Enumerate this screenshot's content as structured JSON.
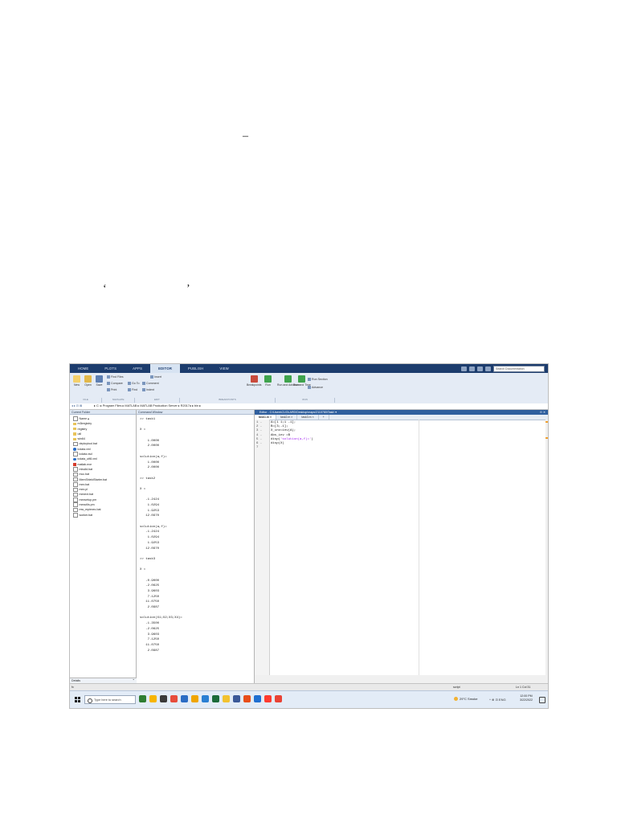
{
  "document": {
    "dash": "–",
    "left_quote": "‘",
    "right_quote": "’"
  },
  "app": {
    "tabs": [
      "HOME",
      "PLOTS",
      "APPS",
      "EDITOR",
      "PUBLISH",
      "VIEW"
    ],
    "active_tab": "EDITOR",
    "search_placeholder": "Search Documentation"
  },
  "ribbon": {
    "items": [
      {
        "label": "New",
        "color": "#f4d06b"
      },
      {
        "label": "Open",
        "color": "#e2b84a"
      },
      {
        "label": "Save",
        "color": "#5d7fb3"
      },
      {
        "label": "Breakpoints",
        "color": "#c94b3c"
      },
      {
        "label": "Run",
        "color": "#3fa34d"
      },
      {
        "label": "Run and Advance",
        "color": "#3fa34d"
      },
      {
        "label": "Run and Time",
        "color": "#3fa34d"
      }
    ],
    "small": [
      "Find Files",
      "Compare",
      "Print",
      "Insert",
      "Comment",
      "Indent",
      "Go To",
      "Find",
      "Run Section",
      "Advance"
    ],
    "groups": [
      "FILE",
      "NAVIGATE",
      "EDIT",
      "BREAKPOINTS",
      "RUN"
    ]
  },
  "address": {
    "nav": "◂ ▸ ⊡ ⊠",
    "path": "▸ C: ▸ Program Files ▸ MATLAB ▸ MATLAB Production Server ▸ R2017a ▸ bin ▸"
  },
  "current_folder": {
    "title": "Current Folder",
    "column": "Name ▴",
    "items": [
      {
        "name": "m3iregistry",
        "icon": "folder"
      },
      {
        "name": "registry",
        "icon": "folder"
      },
      {
        "name": "util",
        "icon": "folder"
      },
      {
        "name": "win64",
        "icon": "folder"
      },
      {
        "name": "deploytool.bat",
        "icon": "file"
      },
      {
        "name": "lcdata.xml",
        "icon": "blue"
      },
      {
        "name": "lcdata.xsd",
        "icon": "file"
      },
      {
        "name": "lcdata_utf8.xml",
        "icon": "blue"
      },
      {
        "name": "matlab.exe",
        "icon": "red"
      },
      {
        "name": "mbuild.bat",
        "icon": "file"
      },
      {
        "name": "mcc.bat",
        "icon": "file"
      },
      {
        "name": "MemShieldStarter.bat",
        "icon": "file"
      },
      {
        "name": "mex.bat",
        "icon": "file"
      },
      {
        "name": "mex.pl",
        "icon": "file"
      },
      {
        "name": "mexext.bat",
        "icon": "file"
      },
      {
        "name": "mexsetup.pm",
        "icon": "file"
      },
      {
        "name": "mexutils.pm",
        "icon": "file"
      },
      {
        "name": "mw_mpiexec.bat",
        "icon": "file"
      },
      {
        "name": "worker.bat",
        "icon": "file"
      }
    ],
    "details": "Details"
  },
  "command_window": {
    "title": "Command Window",
    "lines": [
      ">> task1",
      "",
      "X =",
      "",
      "    1.0000",
      "    2.0000",
      "",
      "solution(a,f)=",
      "    1.0000",
      "    2.0000",
      "",
      ">> task2",
      "",
      "X =",
      "",
      "   -1.2424",
      "    1.0294",
      "    1.9253",
      "   12.0970",
      "",
      "solution(a,f)=",
      "   -1.2424",
      "    1.0294",
      "    1.9253",
      "   12.0970",
      "",
      ">> task3",
      "",
      "X =",
      "",
      "   -0.9000",
      "   -2.0625",
      "    3.9603",
      "    7.1250",
      "   11.0750",
      "    2.0987",
      "",
      "solution(X1;X2;X3;X4)=",
      "   -1.3500",
      "   -2.0625",
      "    3.9603",
      "    7.1250",
      "   11.0750",
      "    2.0987"
    ]
  },
  "editor": {
    "title": "Editor - C:\\Users\\CUOLARD\\Desktop\\maps\\2110780\\Task\\ ▾",
    "tabs": [
      "task1.m",
      "task2.m",
      "task3.m",
      "+"
    ],
    "active_tab": "task1.m",
    "code": [
      {
        "n": "1 -",
        "text": "A=[1 1;1 -1];",
        "str": ""
      },
      {
        "n": "2 -",
        "text": "B=[3;-1];",
        "str": ""
      },
      {
        "n": "3 -",
        "text": "X_inv=inv(A);",
        "str": ""
      },
      {
        "n": "4 -",
        "text": "Abs_inv =B",
        "str": ""
      },
      {
        "n": "5 -",
        "text": "disp(",
        "str": "'solution(a,f)='"
      },
      {
        "n": "6 -",
        "text": "disp(X)",
        "str": ""
      },
      {
        "n": "7",
        "text": "",
        "str": ""
      }
    ]
  },
  "status": {
    "left": "fx",
    "script": "script",
    "position": "Ln  1    Col  31"
  },
  "taskbar": {
    "search": "Type here to search",
    "icons": [
      "#2f7d32",
      "#f7b500",
      "#3a3a3a",
      "#e74c3c",
      "#2b6cc4",
      "#f0a500",
      "#2a7fd3",
      "#1b6b3a",
      "#f2c230",
      "#3b5998",
      "#e84e1b",
      "#1f6fd1",
      "#ff3b30",
      "#e94235"
    ],
    "weather": "29°C  Smoke",
    "tray": "^  ⊕  ⊡  ENG",
    "time": "12:00 PM",
    "date": "3/22/2022"
  }
}
